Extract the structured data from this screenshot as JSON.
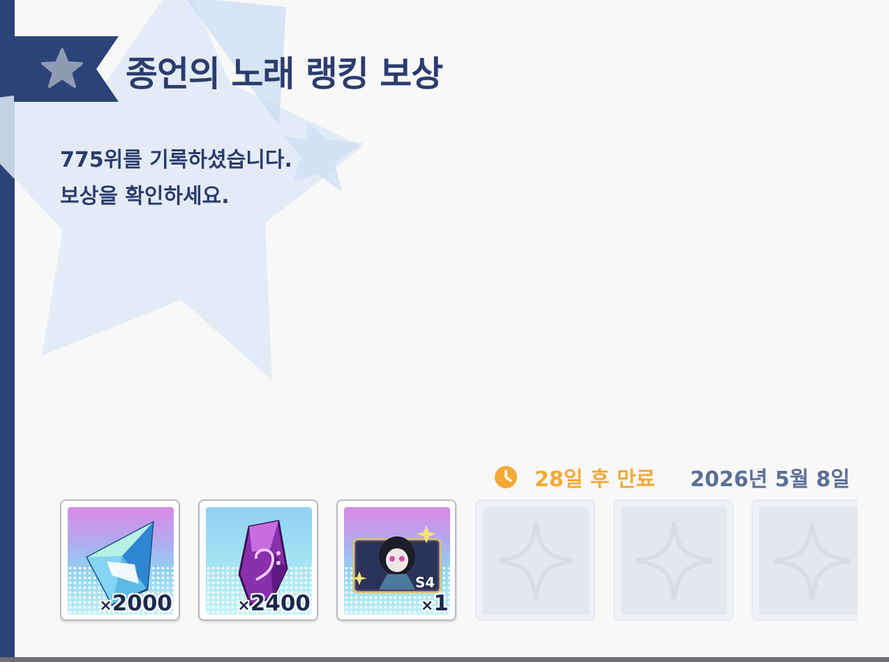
{
  "dialog": {
    "title": "종언의 노래 랭킹 보상",
    "message_line1": "775위를 기록하셨습니다.",
    "message_line2": "보상을 확인하세요."
  },
  "expiry": {
    "remaining": "28일 후 만료",
    "date": "2026년 5월 8일",
    "icon": "clock-icon"
  },
  "rewards": [
    {
      "name": "crystal-icon",
      "quantity": "2000",
      "multiplier": "×"
    },
    {
      "name": "music-gem-icon",
      "quantity": "2400",
      "multiplier": "×"
    },
    {
      "name": "character-card-icon",
      "quantity": "1",
      "multiplier": "×",
      "badge": "S4"
    }
  ],
  "empty_slot_count": 3,
  "colors": {
    "accent_navy": "#2b3c6e",
    "expiry_orange": "#f4a937",
    "date_slate": "#5b6f96",
    "side_bar": "#2b4478"
  }
}
